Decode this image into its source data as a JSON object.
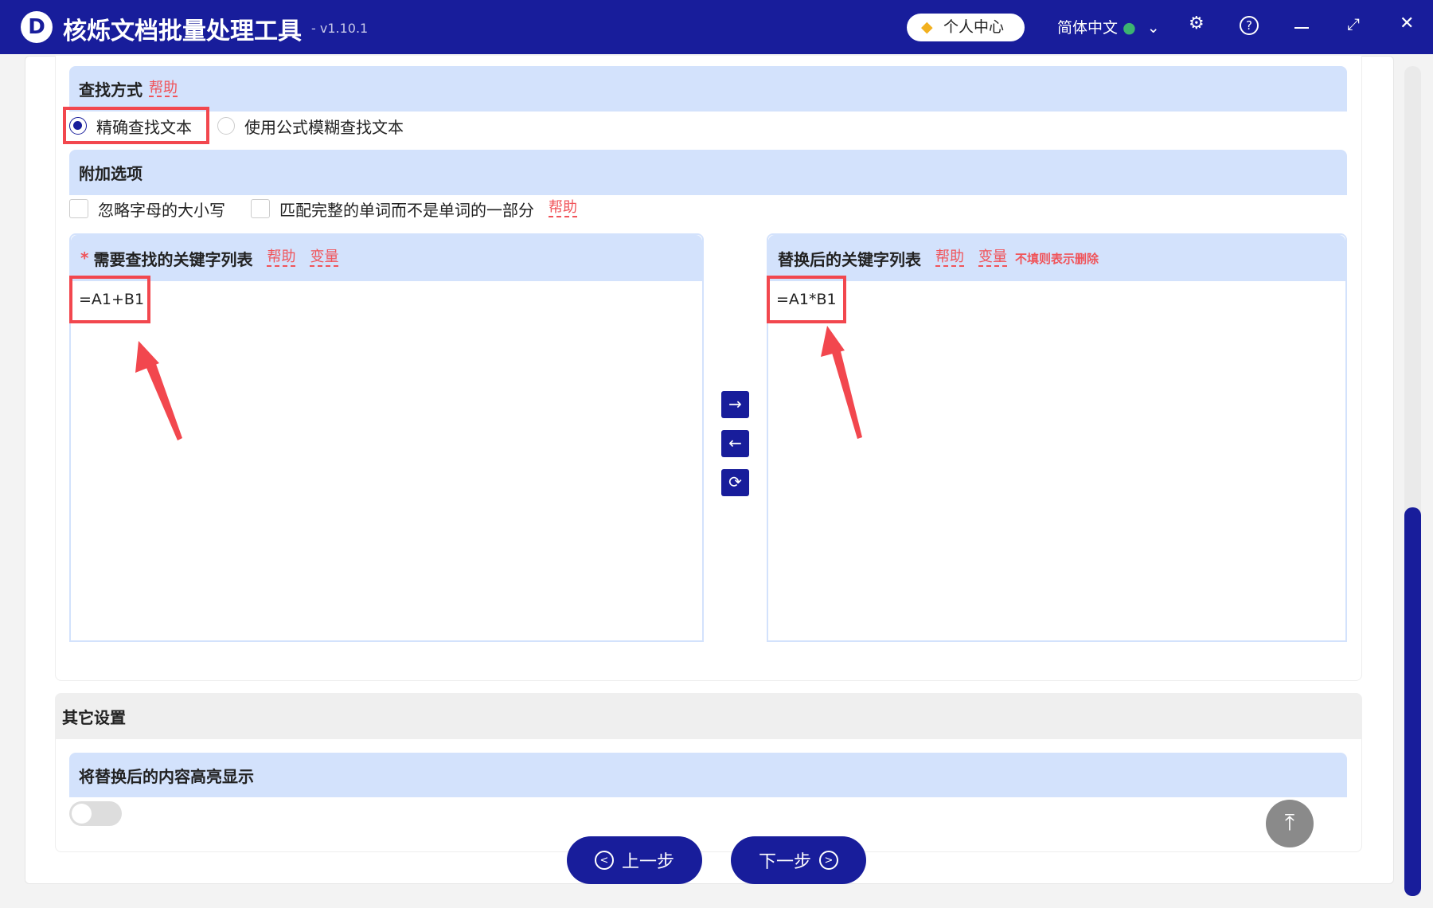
{
  "app": {
    "logo_letter": "D",
    "title": "核烁文档批量处理工具",
    "version": "- v1.10.1",
    "vip_label": "个人中心",
    "language": "简体中文"
  },
  "search_mode": {
    "title": "查找方式",
    "help": "帮助",
    "options": [
      {
        "label": "精确查找文本",
        "selected": true
      },
      {
        "label": "使用公式模糊查找文本",
        "selected": false
      }
    ]
  },
  "extra": {
    "title": "附加选项",
    "options": [
      {
        "label": "忽略字母的大小写",
        "checked": false
      },
      {
        "label": "匹配完整的单词而不是单词的一部分",
        "checked": false
      }
    ],
    "help": "帮助"
  },
  "find_list": {
    "required_mark": "*",
    "title": "需要查找的关键字列表",
    "help": "帮助",
    "variable": "变量",
    "value": "=A1+B1"
  },
  "replace_list": {
    "title": "替换后的关键字列表",
    "help": "帮助",
    "variable": "变量",
    "note": "不填则表示删除",
    "value": "=A1*B1"
  },
  "other": {
    "title": "其它设置",
    "highlight_title": "将替换后的内容高亮显示",
    "highlight_on": false
  },
  "nav": {
    "prev": "上一步",
    "next": "下一步"
  },
  "colors": {
    "primary": "#181d9b",
    "header_bg": "#d3e2fc",
    "accent_red": "#f2474e"
  }
}
